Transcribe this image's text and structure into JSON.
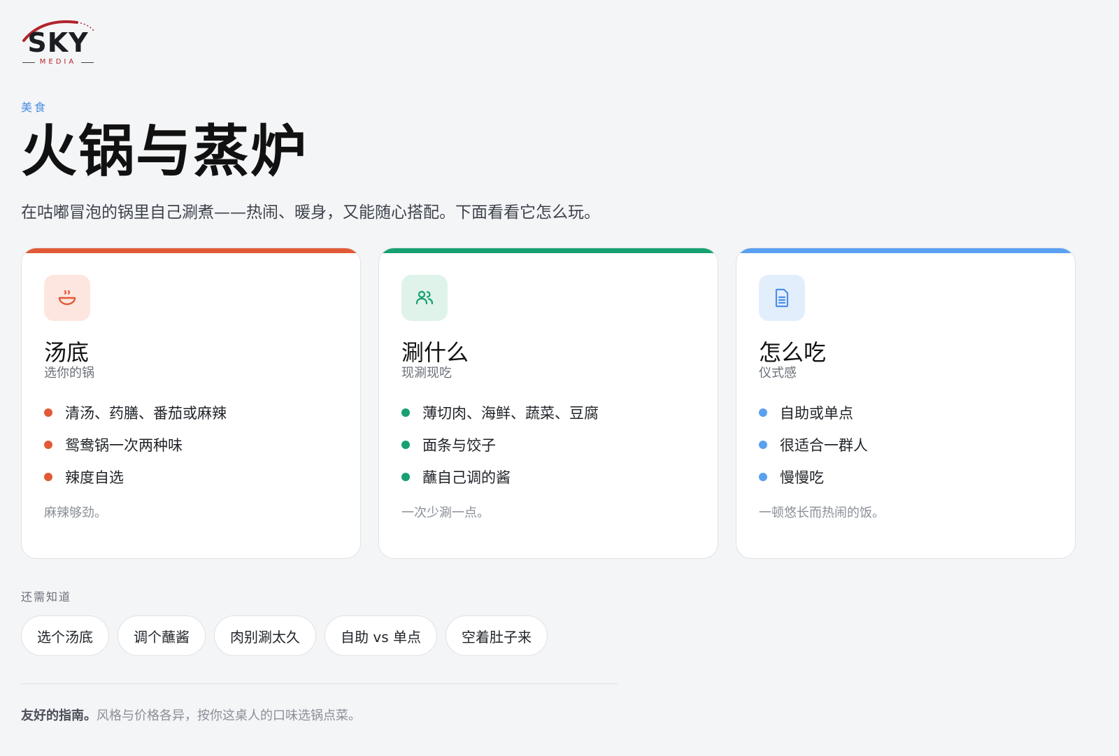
{
  "brand": {
    "name": "SKY",
    "tagline": "MEDIA"
  },
  "category": "美食",
  "title": "火锅与蒸炉",
  "subtitle": "在咕嘟冒泡的锅里自己涮煮——热闹、暖身，又能随心搭配。下面看看它怎么玩。",
  "cards": [
    {
      "heading": "汤底",
      "sub": "选你的锅",
      "icon": "bowl-icon",
      "accent": "#e15a37",
      "icon_bg": "#fde6df",
      "items": [
        "清汤、药膳、番茄或麻辣",
        "鸳鸯锅一次两种味",
        "辣度自选"
      ],
      "note": "麻辣够劲。"
    },
    {
      "heading": "涮什么",
      "sub": "现涮现吃",
      "icon": "people-icon",
      "accent": "#17a070",
      "icon_bg": "#dff3ea",
      "items": [
        "薄切肉、海鲜、蔬菜、豆腐",
        "面条与饺子",
        "蘸自己调的酱"
      ],
      "note": "一次少涮一点。"
    },
    {
      "heading": "怎么吃",
      "sub": "仪式感",
      "icon": "document-icon",
      "accent": "#5b9ff0",
      "icon_bg": "#e3eefc",
      "items": [
        "自助或单点",
        "很适合一群人",
        "慢慢吃"
      ],
      "note": "一顿悠长而热闹的饭。"
    }
  ],
  "extras": {
    "label": "还需知道",
    "chips": [
      "选个汤底",
      "调个蘸酱",
      "肉别涮太久",
      "自助 vs 单点",
      "空着肚子来"
    ]
  },
  "footer": {
    "strong": "友好的指南。",
    "text": "风格与价格各异，按你这桌人的口味选锅点菜。"
  }
}
